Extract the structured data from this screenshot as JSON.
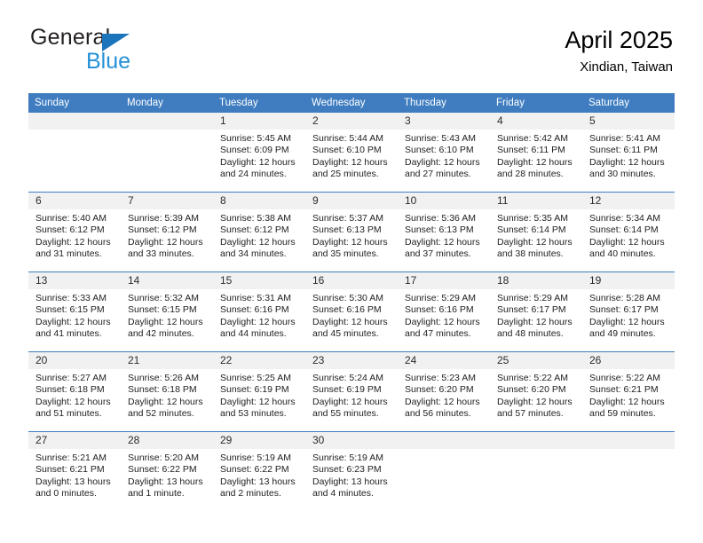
{
  "brand": {
    "name_part1": "General",
    "name_part2": "Blue",
    "accent_color": "#2491d6",
    "triangle_color": "#1b75bb"
  },
  "header": {
    "title": "April 2025",
    "subtitle": "Xindian, Taiwan",
    "header_bg": "#3f7dc0",
    "daynum_bg": "#f1f1f1"
  },
  "weekdays": [
    "Sunday",
    "Monday",
    "Tuesday",
    "Wednesday",
    "Thursday",
    "Friday",
    "Saturday"
  ],
  "weeks": [
    [
      {
        "day": "",
        "sunrise": "",
        "sunset": "",
        "daylight": "",
        "empty": true
      },
      {
        "day": "",
        "sunrise": "",
        "sunset": "",
        "daylight": "",
        "empty": true
      },
      {
        "day": "1",
        "sunrise": "Sunrise: 5:45 AM",
        "sunset": "Sunset: 6:09 PM",
        "daylight": "Daylight: 12 hours and 24 minutes."
      },
      {
        "day": "2",
        "sunrise": "Sunrise: 5:44 AM",
        "sunset": "Sunset: 6:10 PM",
        "daylight": "Daylight: 12 hours and 25 minutes."
      },
      {
        "day": "3",
        "sunrise": "Sunrise: 5:43 AM",
        "sunset": "Sunset: 6:10 PM",
        "daylight": "Daylight: 12 hours and 27 minutes."
      },
      {
        "day": "4",
        "sunrise": "Sunrise: 5:42 AM",
        "sunset": "Sunset: 6:11 PM",
        "daylight": "Daylight: 12 hours and 28 minutes."
      },
      {
        "day": "5",
        "sunrise": "Sunrise: 5:41 AM",
        "sunset": "Sunset: 6:11 PM",
        "daylight": "Daylight: 12 hours and 30 minutes."
      }
    ],
    [
      {
        "day": "6",
        "sunrise": "Sunrise: 5:40 AM",
        "sunset": "Sunset: 6:12 PM",
        "daylight": "Daylight: 12 hours and 31 minutes."
      },
      {
        "day": "7",
        "sunrise": "Sunrise: 5:39 AM",
        "sunset": "Sunset: 6:12 PM",
        "daylight": "Daylight: 12 hours and 33 minutes."
      },
      {
        "day": "8",
        "sunrise": "Sunrise: 5:38 AM",
        "sunset": "Sunset: 6:12 PM",
        "daylight": "Daylight: 12 hours and 34 minutes."
      },
      {
        "day": "9",
        "sunrise": "Sunrise: 5:37 AM",
        "sunset": "Sunset: 6:13 PM",
        "daylight": "Daylight: 12 hours and 35 minutes."
      },
      {
        "day": "10",
        "sunrise": "Sunrise: 5:36 AM",
        "sunset": "Sunset: 6:13 PM",
        "daylight": "Daylight: 12 hours and 37 minutes."
      },
      {
        "day": "11",
        "sunrise": "Sunrise: 5:35 AM",
        "sunset": "Sunset: 6:14 PM",
        "daylight": "Daylight: 12 hours and 38 minutes."
      },
      {
        "day": "12",
        "sunrise": "Sunrise: 5:34 AM",
        "sunset": "Sunset: 6:14 PM",
        "daylight": "Daylight: 12 hours and 40 minutes."
      }
    ],
    [
      {
        "day": "13",
        "sunrise": "Sunrise: 5:33 AM",
        "sunset": "Sunset: 6:15 PM",
        "daylight": "Daylight: 12 hours and 41 minutes."
      },
      {
        "day": "14",
        "sunrise": "Sunrise: 5:32 AM",
        "sunset": "Sunset: 6:15 PM",
        "daylight": "Daylight: 12 hours and 42 minutes."
      },
      {
        "day": "15",
        "sunrise": "Sunrise: 5:31 AM",
        "sunset": "Sunset: 6:16 PM",
        "daylight": "Daylight: 12 hours and 44 minutes."
      },
      {
        "day": "16",
        "sunrise": "Sunrise: 5:30 AM",
        "sunset": "Sunset: 6:16 PM",
        "daylight": "Daylight: 12 hours and 45 minutes."
      },
      {
        "day": "17",
        "sunrise": "Sunrise: 5:29 AM",
        "sunset": "Sunset: 6:16 PM",
        "daylight": "Daylight: 12 hours and 47 minutes."
      },
      {
        "day": "18",
        "sunrise": "Sunrise: 5:29 AM",
        "sunset": "Sunset: 6:17 PM",
        "daylight": "Daylight: 12 hours and 48 minutes."
      },
      {
        "day": "19",
        "sunrise": "Sunrise: 5:28 AM",
        "sunset": "Sunset: 6:17 PM",
        "daylight": "Daylight: 12 hours and 49 minutes."
      }
    ],
    [
      {
        "day": "20",
        "sunrise": "Sunrise: 5:27 AM",
        "sunset": "Sunset: 6:18 PM",
        "daylight": "Daylight: 12 hours and 51 minutes."
      },
      {
        "day": "21",
        "sunrise": "Sunrise: 5:26 AM",
        "sunset": "Sunset: 6:18 PM",
        "daylight": "Daylight: 12 hours and 52 minutes."
      },
      {
        "day": "22",
        "sunrise": "Sunrise: 5:25 AM",
        "sunset": "Sunset: 6:19 PM",
        "daylight": "Daylight: 12 hours and 53 minutes."
      },
      {
        "day": "23",
        "sunrise": "Sunrise: 5:24 AM",
        "sunset": "Sunset: 6:19 PM",
        "daylight": "Daylight: 12 hours and 55 minutes."
      },
      {
        "day": "24",
        "sunrise": "Sunrise: 5:23 AM",
        "sunset": "Sunset: 6:20 PM",
        "daylight": "Daylight: 12 hours and 56 minutes."
      },
      {
        "day": "25",
        "sunrise": "Sunrise: 5:22 AM",
        "sunset": "Sunset: 6:20 PM",
        "daylight": "Daylight: 12 hours and 57 minutes."
      },
      {
        "day": "26",
        "sunrise": "Sunrise: 5:22 AM",
        "sunset": "Sunset: 6:21 PM",
        "daylight": "Daylight: 12 hours and 59 minutes."
      }
    ],
    [
      {
        "day": "27",
        "sunrise": "Sunrise: 5:21 AM",
        "sunset": "Sunset: 6:21 PM",
        "daylight": "Daylight: 13 hours and 0 minutes."
      },
      {
        "day": "28",
        "sunrise": "Sunrise: 5:20 AM",
        "sunset": "Sunset: 6:22 PM",
        "daylight": "Daylight: 13 hours and 1 minute."
      },
      {
        "day": "29",
        "sunrise": "Sunrise: 5:19 AM",
        "sunset": "Sunset: 6:22 PM",
        "daylight": "Daylight: 13 hours and 2 minutes."
      },
      {
        "day": "30",
        "sunrise": "Sunrise: 5:19 AM",
        "sunset": "Sunset: 6:23 PM",
        "daylight": "Daylight: 13 hours and 4 minutes."
      },
      {
        "day": "",
        "sunrise": "",
        "sunset": "",
        "daylight": "",
        "empty": true
      },
      {
        "day": "",
        "sunrise": "",
        "sunset": "",
        "daylight": "",
        "empty": true
      },
      {
        "day": "",
        "sunrise": "",
        "sunset": "",
        "daylight": "",
        "empty": true
      }
    ]
  ]
}
